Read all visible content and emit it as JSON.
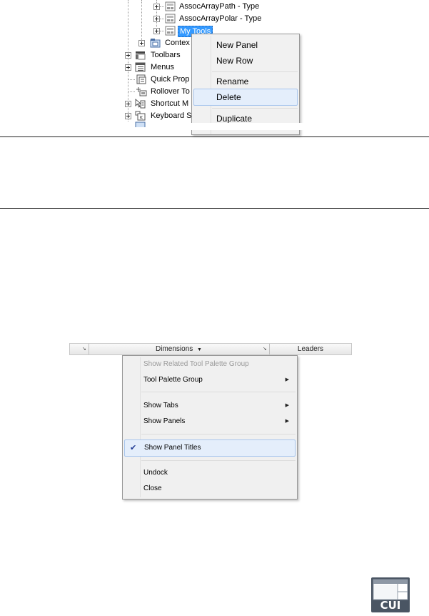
{
  "tree": {
    "items": [
      {
        "label": "AssocArrayPath - Type"
      },
      {
        "label": "AssocArrayPolar - Type"
      },
      {
        "label": "My Tools"
      },
      {
        "label": "Contex"
      },
      {
        "label": "Toolbars"
      },
      {
        "label": "Menus"
      },
      {
        "label": "Quick Prop"
      },
      {
        "label": "Rollover To"
      },
      {
        "label": "Shortcut M"
      },
      {
        "label": "Keyboard S"
      }
    ]
  },
  "panel_context_menu": {
    "items": [
      "New Panel",
      "New Row",
      "Rename",
      "Delete",
      "Duplicate"
    ],
    "highlighted": "Delete"
  },
  "palette_bar": {
    "dimensions_label": "Dimensions",
    "leaders_label": "Leaders"
  },
  "palette_context_menu": {
    "items": [
      {
        "label": "Show Related Tool Palette Group",
        "disabled": true
      },
      {
        "label": "Tool Palette Group",
        "submenu": true
      },
      {
        "label": "Show Tabs",
        "submenu": true
      },
      {
        "label": "Show Panels",
        "submenu": true
      },
      {
        "label": "Show Panel Titles",
        "checked": true
      },
      {
        "label": "Undock"
      },
      {
        "label": "Close"
      }
    ]
  },
  "cui_icon": {
    "label": "CUI"
  }
}
